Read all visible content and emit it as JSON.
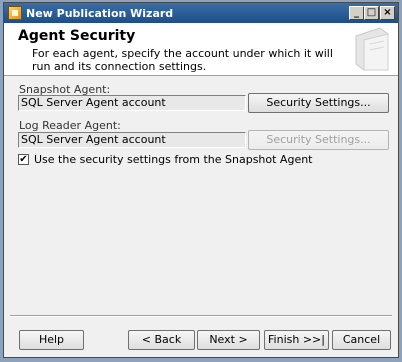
{
  "window": {
    "title": "New Publication Wizard"
  },
  "header": {
    "title": "Agent Security",
    "subtitle": "For each agent, specify the account under which it will run and its connection settings."
  },
  "snapshot_agent": {
    "label": "Snapshot Agent:",
    "value": "SQL Server Agent account",
    "button": "Security Settings..."
  },
  "log_reader_agent": {
    "label": "Log Reader Agent:",
    "value": "SQL Server Agent account",
    "button": "Security Settings..."
  },
  "use_snapshot_settings": {
    "label": "Use the security settings from the Snapshot Agent",
    "checked": true
  },
  "footer": {
    "help": "Help",
    "back": "< Back",
    "next": "Next >",
    "finish": "Finish >>|",
    "cancel": "Cancel"
  }
}
